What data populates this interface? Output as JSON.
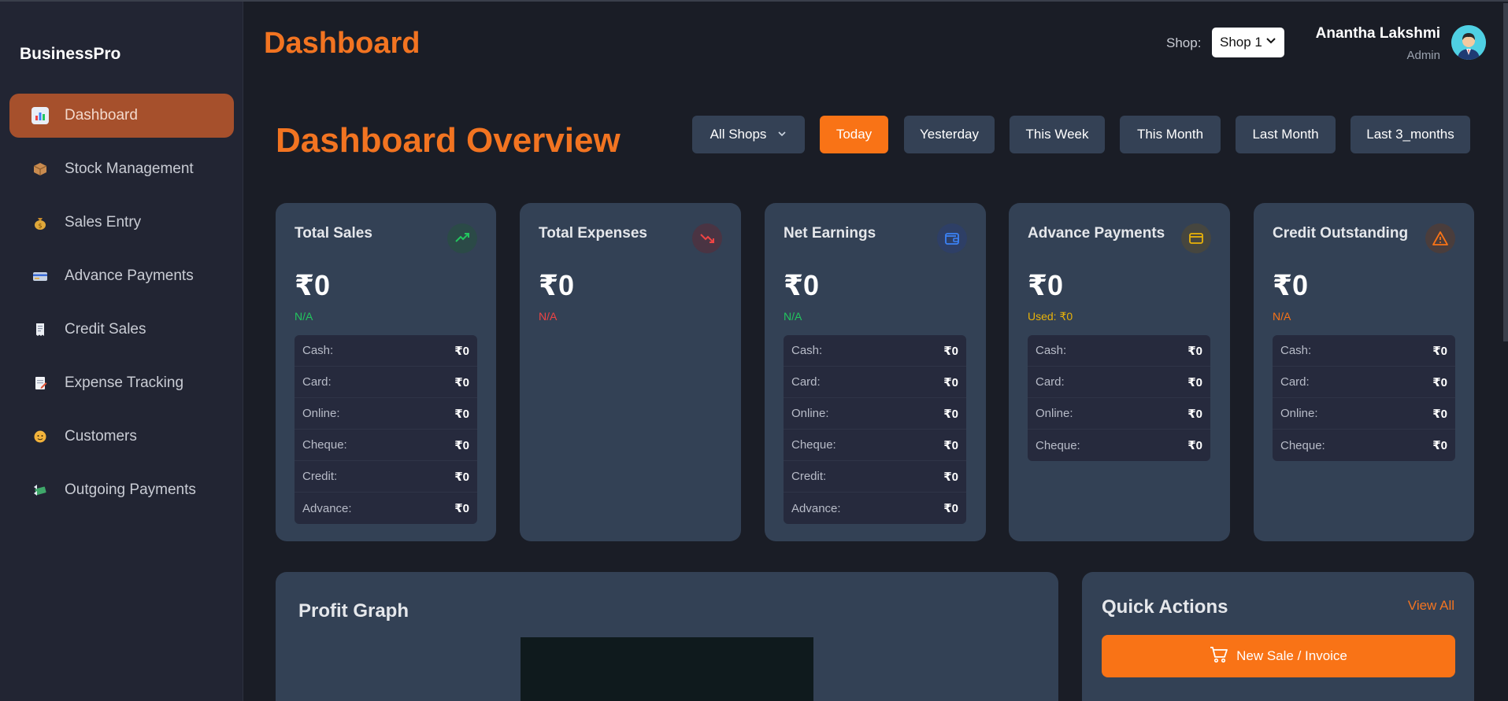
{
  "sidebar": {
    "brand": "BusinessPro",
    "items": [
      {
        "label": "Dashboard",
        "icon": "bar-chart-icon",
        "active": true
      },
      {
        "label": "Stock Management",
        "icon": "package-icon"
      },
      {
        "label": "Sales Entry",
        "icon": "money-bag-icon"
      },
      {
        "label": "Advance Payments",
        "icon": "credit-card-icon"
      },
      {
        "label": "Credit Sales",
        "icon": "receipt-icon"
      },
      {
        "label": "Expense Tracking",
        "icon": "memo-icon"
      },
      {
        "label": "Customers",
        "icon": "person-icon"
      },
      {
        "label": "Outgoing Payments",
        "icon": "flying-money-icon"
      }
    ]
  },
  "header": {
    "title": "Dashboard",
    "shop_label": "Shop:",
    "shop_selected": "Shop 1",
    "user_name": "Anantha Lakshmi",
    "user_role": "Admin"
  },
  "overview": {
    "title": "Dashboard Overview",
    "shop_filter": "All Shops",
    "ranges": [
      "Today",
      "Yesterday",
      "This Week",
      "This Month",
      "Last Month",
      "Last 3_months"
    ],
    "active_range": "Today"
  },
  "cards": [
    {
      "title": "Total Sales",
      "value": "₹0",
      "sub": "N/A",
      "sub_color": "#22c55e",
      "icon": "trend-up-icon",
      "rows": [
        {
          "label": "Cash:",
          "value": "₹0"
        },
        {
          "label": "Card:",
          "value": "₹0"
        },
        {
          "label": "Online:",
          "value": "₹0"
        },
        {
          "label": "Cheque:",
          "value": "₹0"
        },
        {
          "label": "Credit:",
          "value": "₹0"
        },
        {
          "label": "Advance:",
          "value": "₹0"
        }
      ]
    },
    {
      "title": "Total Expenses",
      "value": "₹0",
      "sub": "N/A",
      "sub_color": "#ef4444",
      "icon": "trend-down-icon",
      "rows": []
    },
    {
      "title": "Net Earnings",
      "value": "₹0",
      "sub": "N/A",
      "sub_color": "#22c55e",
      "icon": "wallet-icon",
      "rows": [
        {
          "label": "Cash:",
          "value": "₹0"
        },
        {
          "label": "Card:",
          "value": "₹0"
        },
        {
          "label": "Online:",
          "value": "₹0"
        },
        {
          "label": "Cheque:",
          "value": "₹0"
        },
        {
          "label": "Credit:",
          "value": "₹0"
        },
        {
          "label": "Advance:",
          "value": "₹0"
        }
      ]
    },
    {
      "title": "Advance Payments",
      "value": "₹0",
      "sub": "Used: ₹0",
      "sub_color": "#eab308",
      "icon": "card-icon",
      "rows": [
        {
          "label": "Cash:",
          "value": "₹0"
        },
        {
          "label": "Card:",
          "value": "₹0"
        },
        {
          "label": "Online:",
          "value": "₹0"
        },
        {
          "label": "Cheque:",
          "value": "₹0"
        }
      ]
    },
    {
      "title": "Credit Outstanding",
      "value": "₹0",
      "sub": "N/A",
      "sub_color": "#f97316",
      "icon": "warning-icon",
      "rows": [
        {
          "label": "Cash:",
          "value": "₹0"
        },
        {
          "label": "Card:",
          "value": "₹0"
        },
        {
          "label": "Online:",
          "value": "₹0"
        },
        {
          "label": "Cheque:",
          "value": "₹0"
        }
      ]
    }
  ],
  "profit_graph": {
    "title": "Profit Graph"
  },
  "quick_actions": {
    "title": "Quick Actions",
    "view_all": "View All",
    "new_sale": "New Sale / Invoice"
  },
  "colors": {
    "accent": "#f97316",
    "card_bg": "#334155",
    "page_bg": "#1a1d26"
  }
}
